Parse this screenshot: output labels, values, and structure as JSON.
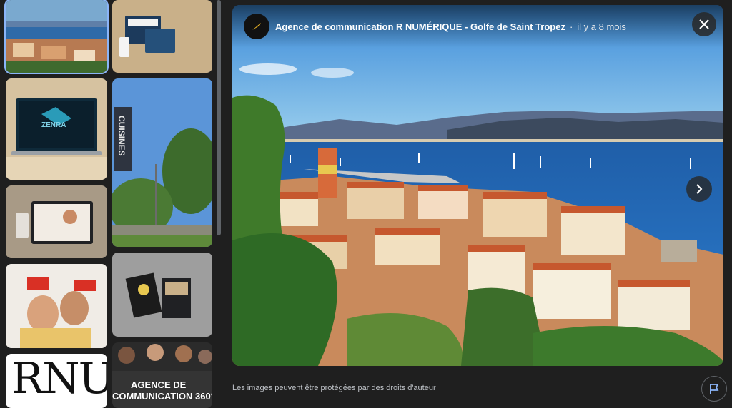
{
  "viewer": {
    "source_name": "Agence de communication R NUMÉRIQUE - Golfe de Saint Tropez",
    "separator": "·",
    "posted_ago": "il y a 8 mois",
    "copyright_notice": "Les images peuvent être protégées par des droits d'auteur"
  },
  "thumbnails": {
    "sign_text": "CUISINES",
    "laptop_site_text": "ZENRA",
    "agency_banner_line1": "AGENCE DE",
    "agency_banner_line2": "COMMUNICATION 360°",
    "logo_text": "RNU"
  },
  "colors": {
    "background": "#1f1f1f",
    "selected_outline": "#8ab4f8",
    "text_secondary": "#bdc1c6"
  },
  "icons": [
    "close-icon",
    "chevron-right-icon",
    "flag-icon",
    "agency-logo-icon"
  ]
}
